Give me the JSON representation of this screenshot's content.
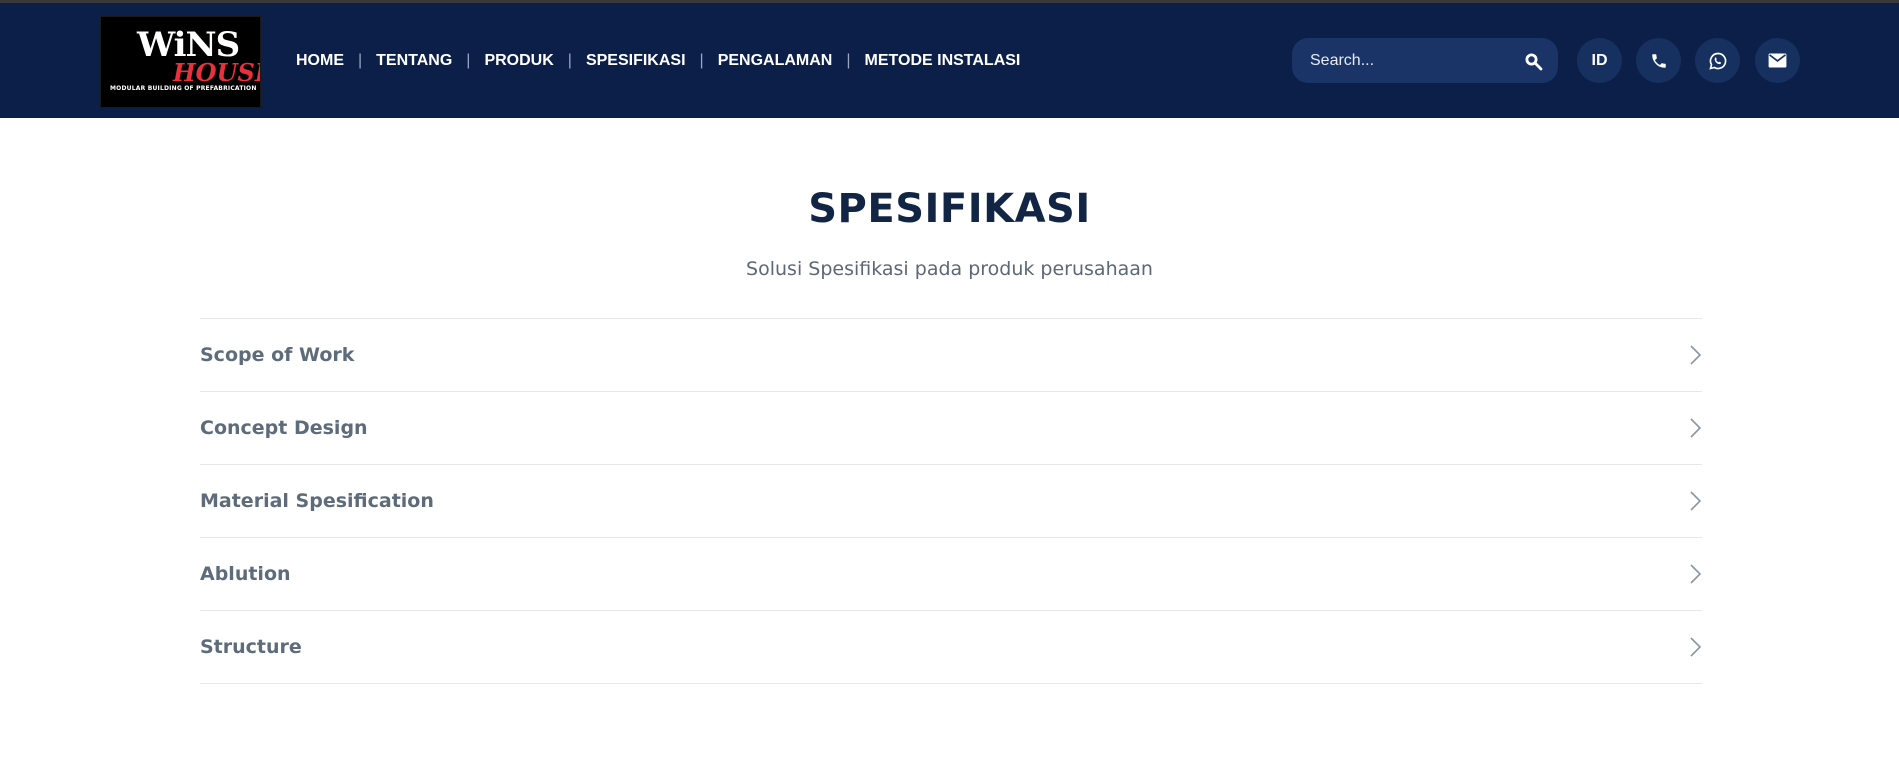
{
  "logo": {
    "line1": "WiNS",
    "line2": "HOUSE",
    "tagline": "MODULAR BUILDING OF PREFABRICATION"
  },
  "nav": {
    "items": [
      {
        "label": "HOME"
      },
      {
        "label": "TENTANG"
      },
      {
        "label": "PRODUK"
      },
      {
        "label": "SPESIFIKASI"
      },
      {
        "label": "PENGALAMAN"
      },
      {
        "label": "METODE INSTALASI"
      }
    ],
    "separator": "|"
  },
  "search": {
    "placeholder": "Search...",
    "icon": "search-icon"
  },
  "header_actions": {
    "language": "ID",
    "phone_icon": "phone-icon",
    "whatsapp_icon": "whatsapp-icon",
    "mail_icon": "mail-icon"
  },
  "main": {
    "title": "SPESIFIKASI",
    "subtitle": "Solusi Spesifikasi pada produk perusahaan",
    "accordion": [
      {
        "label": "Scope of Work",
        "icon": "chevron-right-icon"
      },
      {
        "label": "Concept Design",
        "icon": "chevron-right-icon"
      },
      {
        "label": "Material Spesification",
        "icon": "chevron-right-icon"
      },
      {
        "label": "Ablution",
        "icon": "chevron-right-icon"
      },
      {
        "label": "Structure",
        "icon": "chevron-right-icon"
      }
    ]
  },
  "colors": {
    "header_bg": "#0b1f49",
    "search_bg": "#1a3467",
    "title": "#132544",
    "accordion_text": "#5e6b7a",
    "logo_accent": "#e8313c"
  }
}
